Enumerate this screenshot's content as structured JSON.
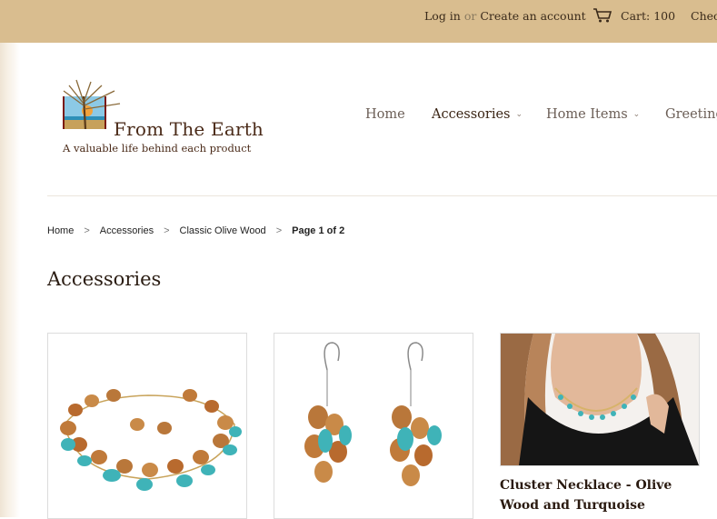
{
  "topbar": {
    "login": "Log in",
    "or": "or",
    "create": "Create an account",
    "cart": "Cart: 100",
    "checkout": "Chec"
  },
  "brand": {
    "name": "From The Earth",
    "tagline": "A valuable life behind each product"
  },
  "nav": {
    "items": [
      {
        "label": "Home"
      },
      {
        "label": "Accessories"
      },
      {
        "label": "Home Items"
      },
      {
        "label": "Greeting"
      }
    ]
  },
  "breadcrumb": {
    "items": [
      "Home",
      "Accessories",
      "Classic Olive Wood",
      "Page 1 of 2"
    ],
    "separator": ">"
  },
  "page": {
    "title": "Accessories"
  },
  "products": [
    {
      "title": ""
    },
    {
      "title": ""
    },
    {
      "title": "Cluster Necklace - Olive Wood and Turquoise"
    }
  ],
  "colors": {
    "topbar": "#d9bd8f",
    "text_dark": "#3a2414",
    "turquoise": "#3fb3b8",
    "olive_wood": "#b9773a"
  }
}
